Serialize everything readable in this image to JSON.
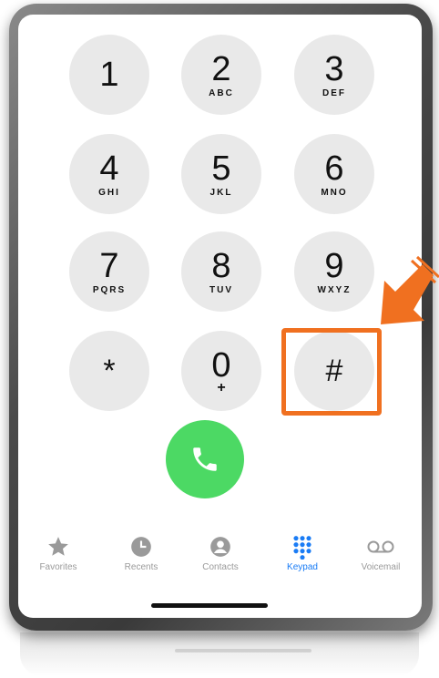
{
  "keypad": {
    "keys": [
      {
        "digit": "1",
        "letters": ""
      },
      {
        "digit": "2",
        "letters": "ABC"
      },
      {
        "digit": "3",
        "letters": "DEF"
      },
      {
        "digit": "4",
        "letters": "GHI"
      },
      {
        "digit": "5",
        "letters": "JKL"
      },
      {
        "digit": "6",
        "letters": "MNO"
      },
      {
        "digit": "7",
        "letters": "PQRS"
      },
      {
        "digit": "8",
        "letters": "TUV"
      },
      {
        "digit": "9",
        "letters": "WXYZ"
      },
      {
        "digit": "*",
        "letters": ""
      },
      {
        "digit": "0",
        "letters": "+"
      },
      {
        "digit": "#",
        "letters": ""
      }
    ]
  },
  "call_button": {
    "icon": "phone-icon",
    "color": "#4cd964"
  },
  "annotation": {
    "highlight_color": "#f07020",
    "target_key": "#"
  },
  "tabbar": {
    "tabs": [
      {
        "label": "Favorites",
        "icon": "star-icon"
      },
      {
        "label": "Recents",
        "icon": "clock-icon"
      },
      {
        "label": "Contacts",
        "icon": "person-icon"
      },
      {
        "label": "Keypad",
        "icon": "keypad-icon",
        "active": true
      },
      {
        "label": "Voicemail",
        "icon": "voicemail-icon"
      }
    ],
    "active_color": "#1a7cf5",
    "inactive_color": "#9a9a9a"
  }
}
